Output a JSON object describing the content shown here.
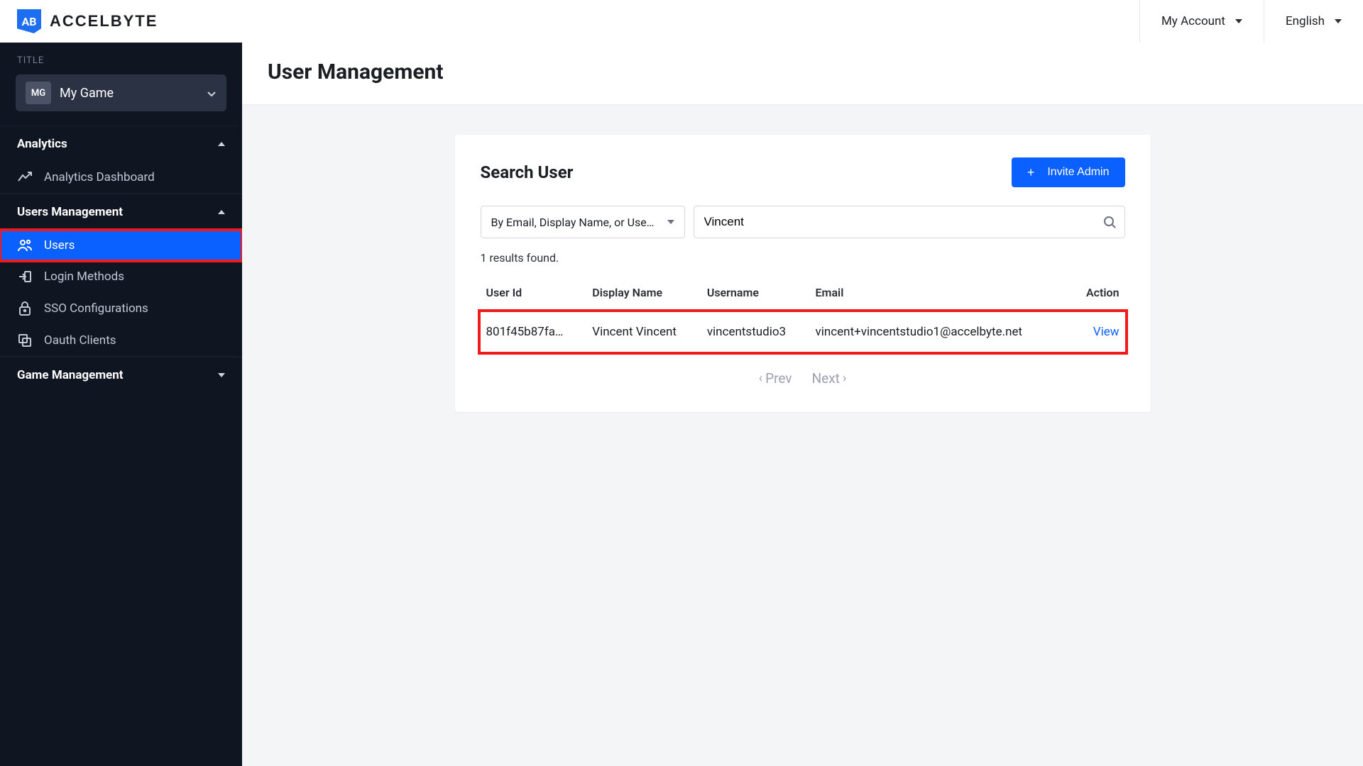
{
  "brand": {
    "logo_text": "AB",
    "name": "ACCELBYTE"
  },
  "topbar": {
    "account_label": "My Account",
    "language_label": "English"
  },
  "sidebar": {
    "title_label": "TITLE",
    "title": {
      "chip": "MG",
      "name": "My Game"
    },
    "sections": {
      "analytics": {
        "label": "Analytics",
        "items": [
          {
            "label": "Analytics Dashboard"
          }
        ]
      },
      "users_management": {
        "label": "Users Management",
        "items": [
          {
            "label": "Users"
          },
          {
            "label": "Login Methods"
          },
          {
            "label": "SSO Configurations"
          },
          {
            "label": "Oauth Clients"
          }
        ]
      },
      "game_management": {
        "label": "Game Management"
      }
    }
  },
  "page": {
    "title": "User Management",
    "search_card": {
      "title": "Search User",
      "invite_button": "Invite Admin",
      "filter_selected": "By Email, Display Name, or Use…",
      "search_value": "Vincent",
      "results_text": "1 results found.",
      "columns": [
        "User Id",
        "Display Name",
        "Username",
        "Email",
        "Action"
      ],
      "rows": [
        {
          "user_id": "801f45b87fa…",
          "display_name": "Vincent Vincent",
          "username": "vincentstudio3",
          "email": "vincent+vincentstudio1@accelbyte.net",
          "action": "View"
        }
      ],
      "pager": {
        "prev": "Prev",
        "next": "Next"
      }
    }
  }
}
